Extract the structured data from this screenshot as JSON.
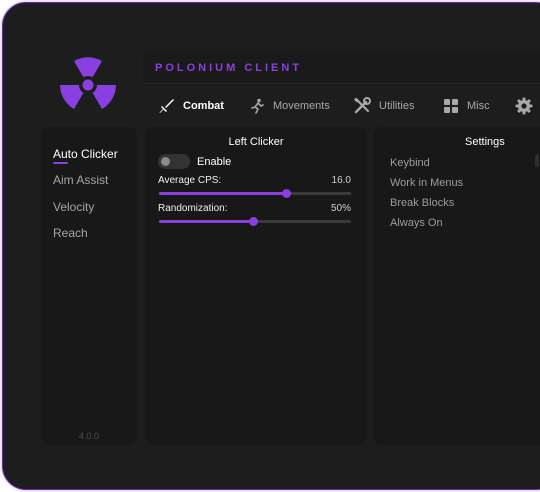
{
  "app": {
    "title": "POLONIUM CLIENT",
    "logo": "radiation-icon",
    "accent_color": "#8a3fe0"
  },
  "tabs": [
    {
      "label": "Combat",
      "icon": "sword-icon",
      "active": true
    },
    {
      "label": "Movements",
      "icon": "running-icon",
      "active": false
    },
    {
      "label": "Utilities",
      "icon": "tools-icon",
      "active": false
    },
    {
      "label": "Misc",
      "icon": "grid-icon",
      "active": false
    },
    {
      "label": "",
      "icon": "gear-icon",
      "active": false
    }
  ],
  "modules": [
    {
      "label": "Auto Clicker",
      "active": true
    },
    {
      "label": "Aim Assist",
      "active": false
    },
    {
      "label": "Velocity",
      "active": false
    },
    {
      "label": "Reach",
      "active": false
    }
  ],
  "version": "4.0.0",
  "module_panel": {
    "title": "Left Clicker",
    "enable_label": "Enable",
    "enabled": false,
    "sliders": [
      {
        "label": "Average CPS:",
        "value": "16.0",
        "fraction": 0.66
      },
      {
        "label": "Randomization:",
        "value": "50%",
        "fraction": 0.49
      }
    ]
  },
  "settings": {
    "title": "Settings",
    "items": [
      "Keybind",
      "Work in Menus",
      "Break Blocks",
      "Always On"
    ]
  }
}
